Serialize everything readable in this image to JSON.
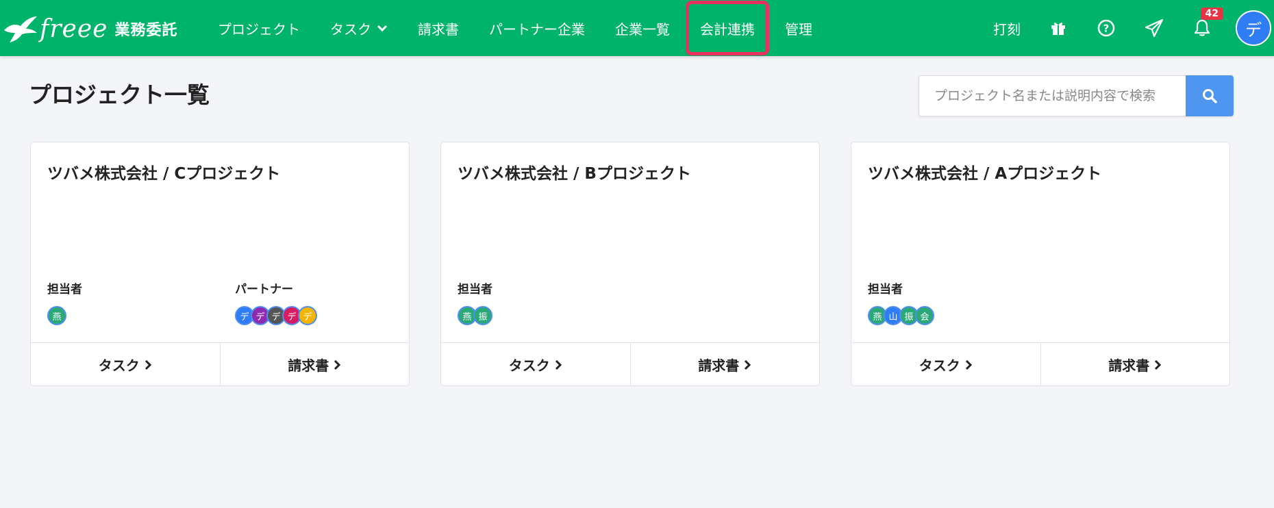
{
  "header": {
    "logo_word": "freee",
    "logo_sub": "業務委託",
    "nav": [
      {
        "label": "プロジェクト"
      },
      {
        "label": "タスク"
      },
      {
        "label": "請求書"
      },
      {
        "label": "パートナー企業"
      },
      {
        "label": "企業一覧"
      },
      {
        "label": "会計連携"
      },
      {
        "label": "管理"
      }
    ],
    "dakoku_label": "打刻",
    "notification_count": "42",
    "user_avatar": "デ",
    "colors": {
      "bar": "#00b36b",
      "highlight": "#e8315f",
      "badge": "#e83347"
    }
  },
  "main": {
    "title": "プロジェクト一覧",
    "search_placeholder": "プロジェクト名または説明内容で検索"
  },
  "cards": [
    {
      "title": "ツバメ株式会社 / Cプロジェクト",
      "assignee_label": "担当者",
      "partner_label": "パートナー",
      "assignees": [
        {
          "text": "燕",
          "color": "#2aa876"
        }
      ],
      "partners": [
        {
          "text": "デ",
          "color": "#2f7df5"
        },
        {
          "text": "デ",
          "color": "#8e2bb0"
        },
        {
          "text": "デ",
          "color": "#555555"
        },
        {
          "text": "デ",
          "color": "#d81b60"
        },
        {
          "text": "デ",
          "color": "#f4b400"
        }
      ],
      "task_label": "タスク",
      "invoice_label": "請求書"
    },
    {
      "title": "ツバメ株式会社 / Bプロジェクト",
      "assignee_label": "担当者",
      "assignees": [
        {
          "text": "燕",
          "color": "#2aa876"
        },
        {
          "text": "振",
          "color": "#2aa876"
        }
      ],
      "task_label": "タスク",
      "invoice_label": "請求書"
    },
    {
      "title": "ツバメ株式会社 / Aプロジェクト",
      "assignee_label": "担当者",
      "assignees": [
        {
          "text": "燕",
          "color": "#2aa876"
        },
        {
          "text": "山",
          "color": "#2f7df5"
        },
        {
          "text": "振",
          "color": "#2aa876"
        },
        {
          "text": "会",
          "color": "#2aa876"
        }
      ],
      "task_label": "タスク",
      "invoice_label": "請求書"
    }
  ]
}
